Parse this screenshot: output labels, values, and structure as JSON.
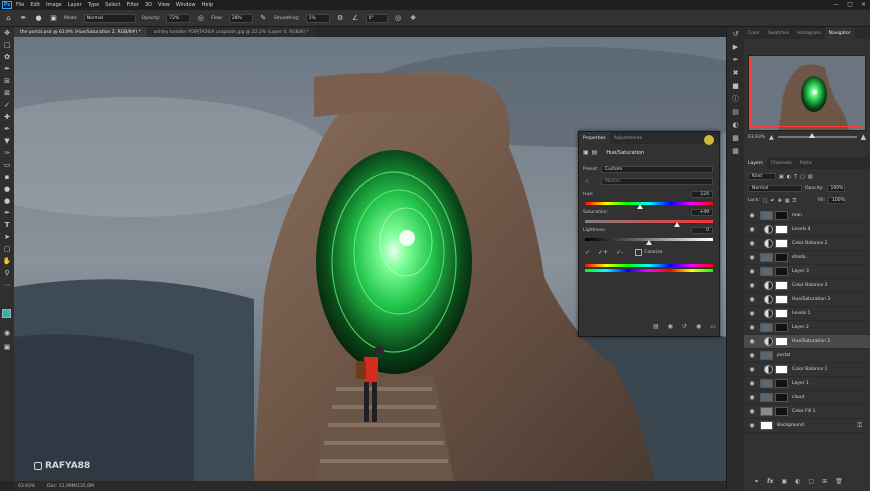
{
  "menubar": {
    "logo": "Ps",
    "items": [
      "File",
      "Edit",
      "Image",
      "Layer",
      "Type",
      "Select",
      "Filter",
      "3D",
      "View",
      "Window",
      "Help"
    ]
  },
  "options": {
    "mode_label": "Mode:",
    "mode_value": "Normal",
    "opacity_label": "Opacity:",
    "opacity_value": "72%",
    "flow_label": "Flow:",
    "flow_value": "28%",
    "smoothing_label": "Smoothing:",
    "smoothing_value": "1%",
    "angle_value": "0°"
  },
  "tabs": [
    {
      "label": "the portal.psd @ 63,9% (Hue/Saturation 2, RGB/8#) *",
      "active": true
    },
    {
      "label": "ashley knedler P5lPjTA56iA unsplash.jpg @ 22,2% (Layer 0, RGB/8) *",
      "active": false
    }
  ],
  "canvas": {
    "watermark": "RAFYA88"
  },
  "status": {
    "zoom": "63.93%",
    "doc": "Doc: 11,99M/135,0M"
  },
  "navigator": {
    "tabs": [
      "Color",
      "Swatches",
      "Histogram",
      "Navigator"
    ],
    "active": "Navigator",
    "zoom": "63,93%"
  },
  "layers_panel": {
    "tabs": [
      "Layers",
      "Channels",
      "Paths"
    ],
    "kind": "Kind",
    "blend": "Normal",
    "opacity_label": "Opacity:",
    "opacity_value": "100%",
    "lock_label": "Lock:",
    "fill_label": "Fill:",
    "fill_value": "100%",
    "layers": [
      {
        "name": "man",
        "type": "pixel",
        "selected": false
      },
      {
        "name": "Levels 4",
        "type": "adj",
        "selected": false
      },
      {
        "name": "Color Balance 2",
        "type": "adj",
        "selected": false
      },
      {
        "name": "shado..",
        "type": "pixel",
        "selected": false
      },
      {
        "name": "Layer 3",
        "type": "pixel",
        "selected": false
      },
      {
        "name": "Color Balance 3",
        "type": "adj",
        "selected": false
      },
      {
        "name": "Hue/Saturation 3",
        "type": "adj",
        "selected": false
      },
      {
        "name": "Levels 1",
        "type": "adj",
        "selected": false
      },
      {
        "name": "Layer 2",
        "type": "pixel",
        "selected": false
      },
      {
        "name": "Hue/Saturation 2",
        "type": "adj",
        "selected": true
      },
      {
        "name": "portal",
        "type": "pixel",
        "selected": false
      },
      {
        "name": "Color Balance 1",
        "type": "adj",
        "selected": false
      },
      {
        "name": "Layer 1",
        "type": "pixel",
        "selected": false
      },
      {
        "name": "cloud",
        "type": "pixel",
        "selected": false
      },
      {
        "name": "Color Fill 1",
        "type": "fill",
        "selected": false
      },
      {
        "name": "Background",
        "type": "pixel",
        "selected": false
      }
    ]
  },
  "properties": {
    "tabs": [
      "Properties",
      "Adjustments"
    ],
    "title": "Hue/Saturation",
    "preset_label": "Preset:",
    "preset_value": "Custom",
    "channel_value": "Master",
    "hue_label": "Hue:",
    "hue_value": "124",
    "hue_fraction": 0.43,
    "saturation_label": "Saturation:",
    "saturation_value": "+49",
    "saturation_fraction": 0.72,
    "lightness_label": "Lightness:",
    "lightness_value": "0",
    "lightness_fraction": 0.5,
    "colorize_label": "Colorize"
  },
  "colors": {
    "fg": "#2fb5a8",
    "bg": "#1a1a1a",
    "portal": "#3dff6a",
    "accent": "#31a8ff"
  }
}
